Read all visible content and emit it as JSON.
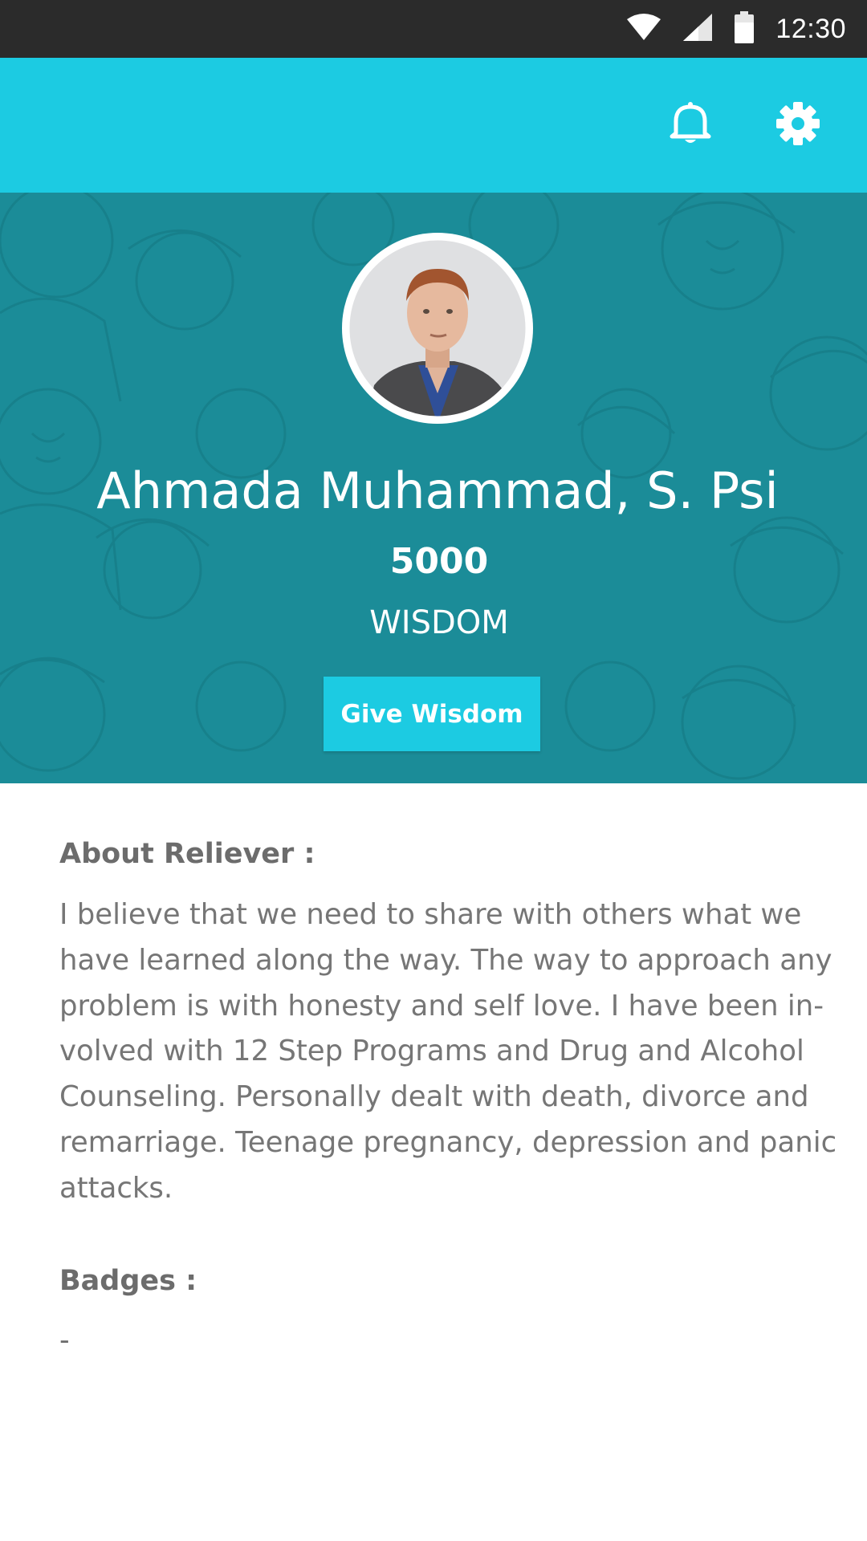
{
  "status_bar": {
    "time": "12:30",
    "icons": [
      "wifi-icon",
      "signal-icon",
      "battery-icon"
    ]
  },
  "app_bar": {
    "actions": [
      "bell-icon",
      "gear-icon"
    ],
    "color": "#1ccbe2"
  },
  "profile": {
    "name": "Ahmada Muhammad, S. Psi",
    "points": "5000",
    "points_label": "WISDOM",
    "give_button_label": "Give Wisdom",
    "hero_color": "#1b8c98"
  },
  "about": {
    "title": "About Reliever :",
    "lines": [
      "I believe that we need to share with others what we",
      "have learned along the way. The way to approach any",
      "problem is with honesty and self love. I have been in-",
      "volved with 12 Step Programs and Drug and Alcohol",
      "Counseling. Personally dealt with death, divorce and",
      "remarriage. Teenage pregnancy, depression and panic",
      "attacks."
    ]
  },
  "badges": {
    "title": "Badges :",
    "value": "-"
  }
}
